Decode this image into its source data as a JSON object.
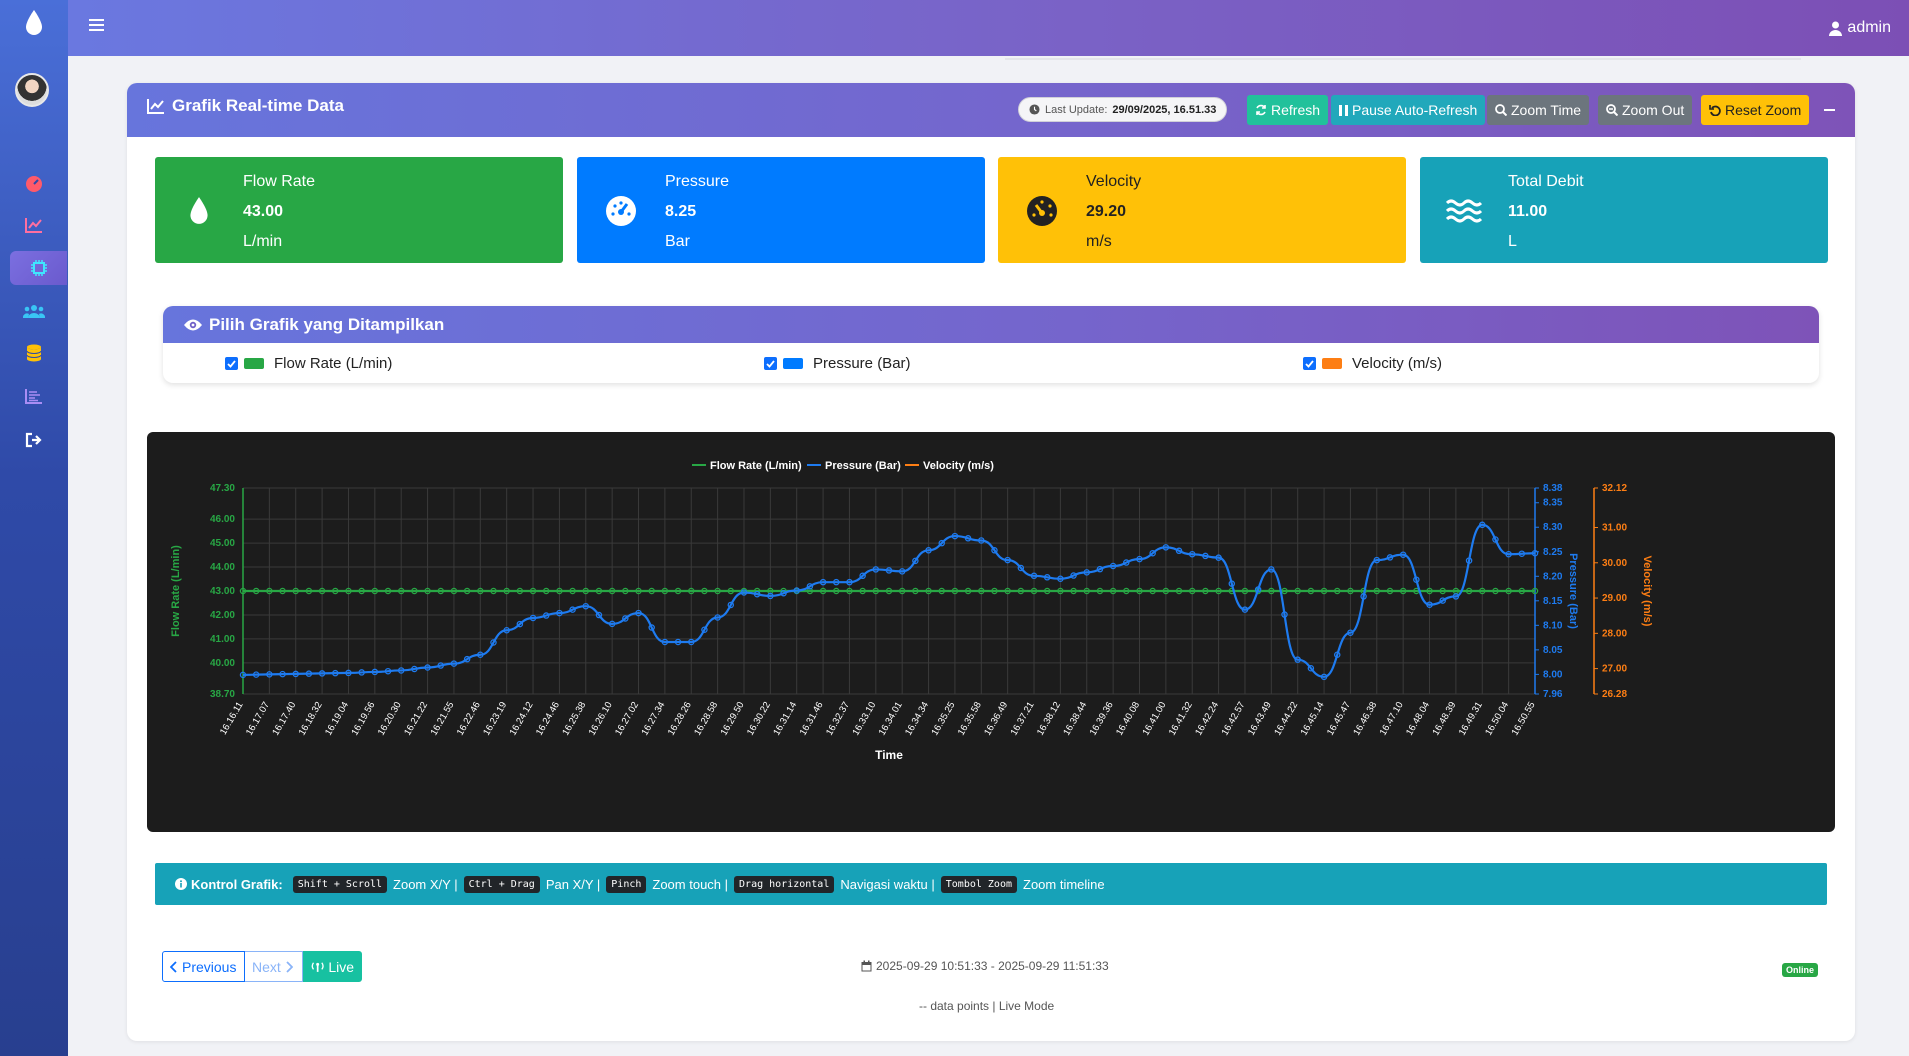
{
  "nav": {
    "user": "admin"
  },
  "header": {
    "title": "Grafik Real-time Data",
    "last_update_label": "Last Update:",
    "last_update_value": "29/09/2025, 16.51.33",
    "buttons": {
      "refresh": "Refresh",
      "pause": "Pause Auto-Refresh",
      "zoom_time": "Zoom Time",
      "zoom_out": "Zoom Out",
      "reset_zoom": "Reset Zoom"
    }
  },
  "stats": [
    {
      "label": "Flow Rate",
      "value": "43.00",
      "unit": "L/min"
    },
    {
      "label": "Pressure",
      "value": "8.25",
      "unit": "Bar"
    },
    {
      "label": "Velocity",
      "value": "29.20",
      "unit": "m/s"
    },
    {
      "label": "Total Debit",
      "value": "11.00",
      "unit": "L"
    }
  ],
  "selector": {
    "title": "Pilih Grafik yang Ditampilkan",
    "options": [
      {
        "label": "Flow Rate (L/min)",
        "color": "#28a745"
      },
      {
        "label": "Pressure (Bar)",
        "color": "#007bff"
      },
      {
        "label": "Velocity (m/s)",
        "color": "#fd7e14"
      }
    ]
  },
  "chart_data": {
    "type": "line",
    "xlabel": "Time",
    "legend": [
      "Flow Rate (L/min)",
      "Pressure (Bar)",
      "Velocity (m/s)"
    ],
    "legend_position": "top-center",
    "grid": true,
    "x_ticks": [
      "16.16.11",
      "16.17.07",
      "16.17.40",
      "16.18.32",
      "16.19.04",
      "16.19.56",
      "16.20.30",
      "16.21.22",
      "16.21.55",
      "16.22.46",
      "16.23.19",
      "16.24.12",
      "16.24.46",
      "16.25.38",
      "16.26.10",
      "16.27.02",
      "16.27.34",
      "16.28.26",
      "16.28.58",
      "16.29.50",
      "16.30.22",
      "16.31.14",
      "16.31.46",
      "16.32.37",
      "16.33.10",
      "16.34.01",
      "16.34.34",
      "16.35.25",
      "16.35.58",
      "16.36.49",
      "16.37.21",
      "16.38.12",
      "16.38.44",
      "16.39.36",
      "16.40.08",
      "16.41.00",
      "16.41.32",
      "16.42.24",
      "16.42.57",
      "16.43.49",
      "16.44.22",
      "16.45.14",
      "16.45.47",
      "16.46.38",
      "16.47.10",
      "16.48.04",
      "16.48.39",
      "16.49.31",
      "16.50.04",
      "16.50.55"
    ],
    "y_left": {
      "label": "Flow Rate (L/min)",
      "ticks": [
        "47.30",
        "46.00",
        "45.00",
        "44.00",
        "43.00",
        "42.00",
        "41.00",
        "40.00",
        "38.70"
      ],
      "min": 38.7,
      "max": 47.3
    },
    "y_right1": {
      "label": "Pressure (Bar)",
      "ticks": [
        "8.38",
        "8.35",
        "8.30",
        "8.25",
        "8.20",
        "8.15",
        "8.10",
        "8.05",
        "8.00",
        "7.96"
      ],
      "min": 7.96,
      "max": 8.38
    },
    "y_right2": {
      "label": "Velocity (m/s)",
      "ticks": [
        "32.12",
        "31.00",
        "30.00",
        "29.00",
        "28.00",
        "27.00",
        "26.28"
      ],
      "min": 26.28,
      "max": 32.12
    },
    "series": [
      {
        "name": "Flow Rate (L/min)",
        "axis": "left",
        "color": "#28a745",
        "values": [
          43.0,
          43.0,
          43.0,
          43.0,
          43.0,
          43.0,
          43.0,
          43.0,
          43.0,
          43.0,
          43.0,
          43.0,
          43.0,
          43.0,
          43.0,
          43.0,
          43.0,
          43.0,
          43.0,
          43.0,
          43.0,
          43.0,
          43.0,
          43.0,
          43.0,
          43.0,
          43.0,
          43.0,
          43.0,
          43.0,
          43.0,
          43.0,
          43.0,
          43.0,
          43.0,
          43.0,
          43.0,
          43.0,
          43.0,
          43.0,
          43.0,
          43.0,
          43.0,
          43.0,
          43.0,
          43.0,
          43.0,
          43.0,
          43.0,
          43.0
        ]
      },
      {
        "name": "Pressure (Bar)",
        "axis": "right1",
        "color": "#1e7bf0",
        "values": [
          7.999,
          8.0,
          8.001,
          8.002,
          8.003,
          8.005,
          8.008,
          8.014,
          8.022,
          8.04,
          8.09,
          8.115,
          8.125,
          8.139,
          8.103,
          8.125,
          8.066,
          8.066,
          8.116,
          8.167,
          8.16,
          8.171,
          8.188,
          8.188,
          8.214,
          8.21,
          8.253,
          8.282,
          8.273,
          8.233,
          8.201,
          8.195,
          8.208,
          8.221,
          8.235,
          8.259,
          8.245,
          8.238,
          8.132,
          8.214,
          8.03,
          7.995,
          8.085,
          8.233,
          8.244,
          8.142,
          8.159,
          8.305,
          8.245,
          8.247
        ]
      },
      {
        "name": "Velocity (m/s)",
        "axis": "right2",
        "color": "#fd7e14",
        "values": []
      }
    ]
  },
  "controls": {
    "label": "Kontrol Grafik:",
    "items": [
      {
        "key": "Shift + Scroll",
        "desc": "Zoom X/Y |"
      },
      {
        "key": "Ctrl + Drag",
        "desc": "Pan X/Y |"
      },
      {
        "key": "Pinch",
        "desc": "Zoom touch |"
      },
      {
        "key": "Drag horizontal",
        "desc": "Navigasi waktu |"
      },
      {
        "key": "Tombol Zoom",
        "desc": "Zoom timeline"
      }
    ]
  },
  "pager": {
    "previous": "Previous",
    "next": "Next",
    "live": "Live"
  },
  "footer": {
    "range": "2025-09-29 10:51:33 - 2025-09-29 11:51:33",
    "points": "-- data points | Live Mode",
    "status": "Online"
  }
}
